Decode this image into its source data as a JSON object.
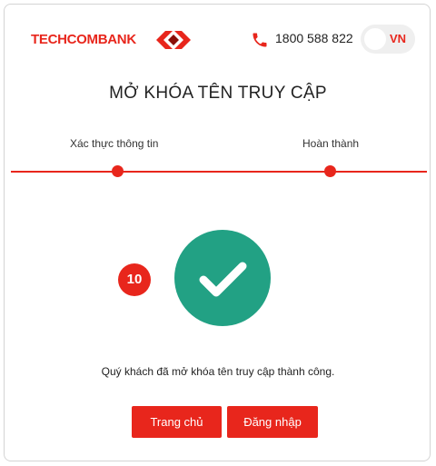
{
  "header": {
    "brand": "TECHCOMBANK",
    "hotline": "1800 588 822",
    "language": "VN",
    "brand_color": "#e8261c"
  },
  "page": {
    "title": "MỞ KHÓA TÊN TRUY CẬP"
  },
  "steps": [
    {
      "label": "Xác thực thông tin",
      "state": "complete"
    },
    {
      "label": "Hoàn thành",
      "state": "complete"
    }
  ],
  "annotation": {
    "badge": "10",
    "badge_color": "#e8261c"
  },
  "result": {
    "icon": "check-icon",
    "icon_color": "#22a184",
    "message": "Quý khách đã mở khóa tên truy cập thành công."
  },
  "actions": {
    "home_label": "Trang chủ",
    "login_label": "Đăng nhập"
  }
}
